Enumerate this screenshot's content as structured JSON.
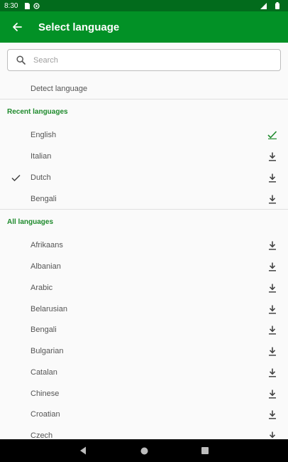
{
  "status_bar": {
    "time": "8:30"
  },
  "app_bar": {
    "title": "Select language"
  },
  "search": {
    "placeholder": "Search",
    "value": ""
  },
  "detect": {
    "label": "Detect language"
  },
  "recent": {
    "header": "Recent languages",
    "items": [
      {
        "label": "English",
        "selected": false,
        "status": "downloaded"
      },
      {
        "label": "Italian",
        "selected": false,
        "status": "download"
      },
      {
        "label": "Dutch",
        "selected": true,
        "status": "download"
      },
      {
        "label": "Bengali",
        "selected": false,
        "status": "download"
      }
    ]
  },
  "all": {
    "header": "All languages",
    "items": [
      {
        "label": "Afrikaans"
      },
      {
        "label": "Albanian"
      },
      {
        "label": "Arabic"
      },
      {
        "label": "Belarusian"
      },
      {
        "label": "Bengali"
      },
      {
        "label": "Bulgarian"
      },
      {
        "label": "Catalan"
      },
      {
        "label": "Chinese"
      },
      {
        "label": "Croatian"
      },
      {
        "label": "Czech"
      }
    ]
  },
  "colors": {
    "app_bar": "#029126",
    "status_bar": "#026b1c",
    "accent": "#1e8a2c"
  },
  "icons": {
    "back": "arrow-back-icon",
    "search": "search-icon",
    "download": "download-icon",
    "check": "check-icon"
  }
}
